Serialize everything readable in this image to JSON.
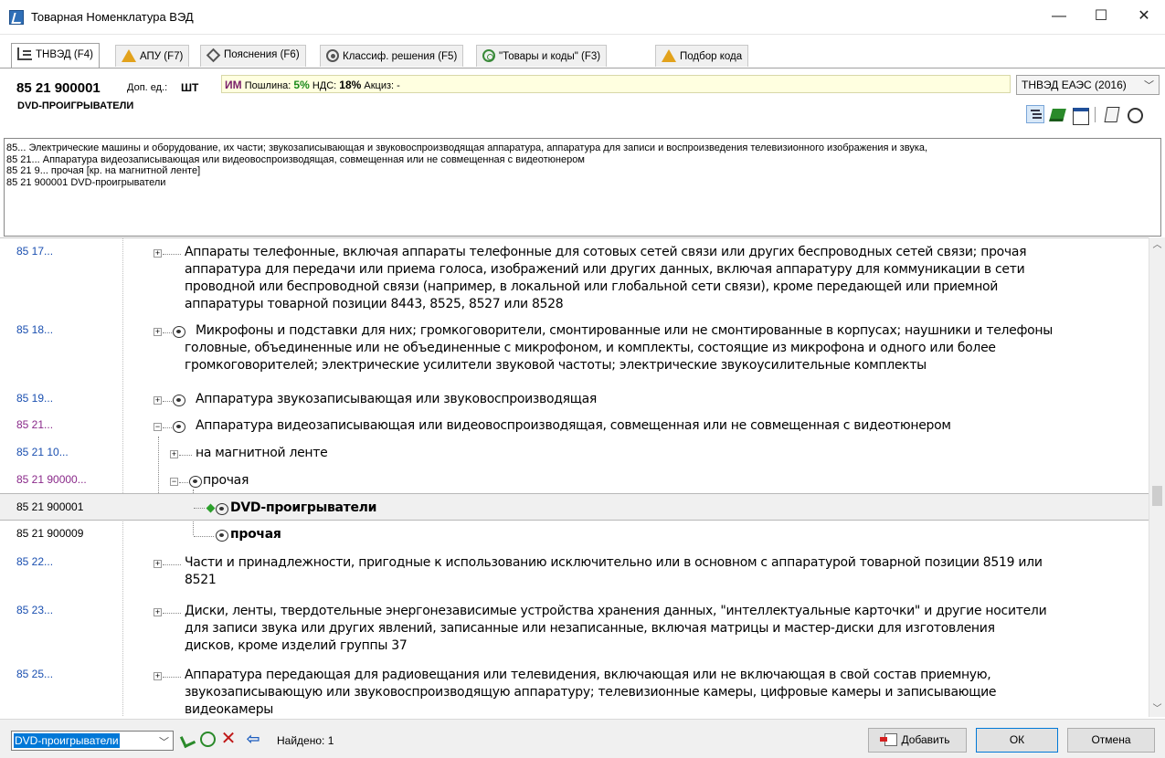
{
  "window": {
    "title": "Товарная Номенклатура ВЭД",
    "controls": {
      "minimize": "—",
      "maximize": "☐",
      "close": "✕"
    }
  },
  "tabs": [
    {
      "label": "ТНВЭД (F4)",
      "icon": "tree-icon",
      "active": true
    },
    {
      "label": "АПУ (F7)",
      "icon": "warning-icon",
      "active": false
    },
    {
      "label": "Пояснения (F6)",
      "icon": "diamond-icon",
      "active": false
    },
    {
      "label": "Классиф. решения (F5)",
      "icon": "eye-icon",
      "active": false
    },
    {
      "label": "\"Товары и коды\" (F3)",
      "icon": "disc-icon",
      "active": false
    },
    {
      "label": "Подбор кода",
      "icon": "warning-icon",
      "active": false
    }
  ],
  "header": {
    "code": "85 21 900001",
    "unit_label": "Доп. ед.:",
    "unit_value": "ШТ",
    "im_label": "ИМ",
    "duty_label": "Пошлина:",
    "duty_value": "5%",
    "vat_label": "НДС:",
    "vat_value": "18%",
    "excise_label": "Акциз:",
    "excise_value": "-",
    "name": "DVD-ПРОИГРЫВАТЕЛИ",
    "edition": "ТНВЭД ЕАЭС (2016)"
  },
  "path_lines": [
    "85...   Электрические машины и оборудование, их части; звукозаписывающая и звуковоспроизводящая аппаратура, аппаратура для записи и воспроизведения телевизионного изображения и звука,",
    "85 21...   Аппаратура видеозаписывающая или видеовоспроизводящая, совмещенная или не совмещенная с видеотюнером",
    "85 21 9...   прочая [кр. на магнитной ленте]",
    "85 21 900001   DVD-проигрыватели"
  ],
  "tree": [
    {
      "code": "85 17...",
      "text": [
        "Аппараты телефонные, включая аппараты телефонные для сотовых сетей связи или других беспроводных сетей связи; прочая",
        "аппаратура для передачи или приема голоса, изображений или других данных, включая аппаратуру для коммуникации в сети",
        "проводной или беспроводной связи (например, в локальной или глобальной сети связи), кроме передающей или приемной",
        "аппаратуры товарной позиции 8443, 8525, 8527 или 8528"
      ]
    },
    {
      "code": "85 18...",
      "text": [
        "Микрофоны и подставки для них; громкоговорители, смонтированные или не смонтированные в корпусах; наушники и телефоны",
        "головные, объединенные или не объединенные с микрофоном, и комплекты, состоящие из микрофона и одного или более",
        "громкоговорителей; электрические усилители звуковой частоты; электрические звукоусилительные комплекты"
      ]
    },
    {
      "code": "85 19...",
      "text": [
        "Аппаратура звукозаписывающая или звуковоспроизводящая"
      ]
    },
    {
      "code": "85 21...",
      "text": [
        "Аппаратура видеозаписывающая или видеовоспроизводящая, совмещенная или не совмещенная с видеотюнером"
      ]
    },
    {
      "code": "85 21 10...",
      "text": [
        "на магнитной ленте"
      ]
    },
    {
      "code": "85 21 90000...",
      "text": [
        "прочая"
      ]
    },
    {
      "code": "85 21 900001",
      "text": [
        "DVD-проигрыватели"
      ]
    },
    {
      "code": "85 21 900009",
      "text": [
        "прочая"
      ]
    },
    {
      "code": "85 22...",
      "text": [
        "Части и принадлежности, пригодные к использованию исключительно или в основном с аппаратурой товарной позиции 8519 или",
        "8521"
      ]
    },
    {
      "code": "85 23...",
      "text": [
        "Диски, ленты, твердотельные энергонезависимые устройства хранения данных, \"интеллектуальные карточки\" и другие носители",
        "для записи звука или других явлений, записанные или незаписанные, включая матрицы и мастер-диски для изготовления",
        "дисков, кроме изделий группы 37"
      ]
    },
    {
      "code": "85 25...",
      "text": [
        "Аппаратура передающая для радиовещания или телевидения, включающая или не включающая в свой состав приемную,",
        "звукозаписывающую или звуковоспроизводящую аппаратуру; телевизионные камеры, цифровые камеры и записывающие",
        "видеокамеры"
      ]
    }
  ],
  "bottom": {
    "search_value": "DVD-проигрыватели",
    "found_label": "Найдено: 1",
    "add_label_u": "Д",
    "add_label_rest": "обавить",
    "ok_label": "ОК",
    "cancel_label": "Отмена"
  }
}
